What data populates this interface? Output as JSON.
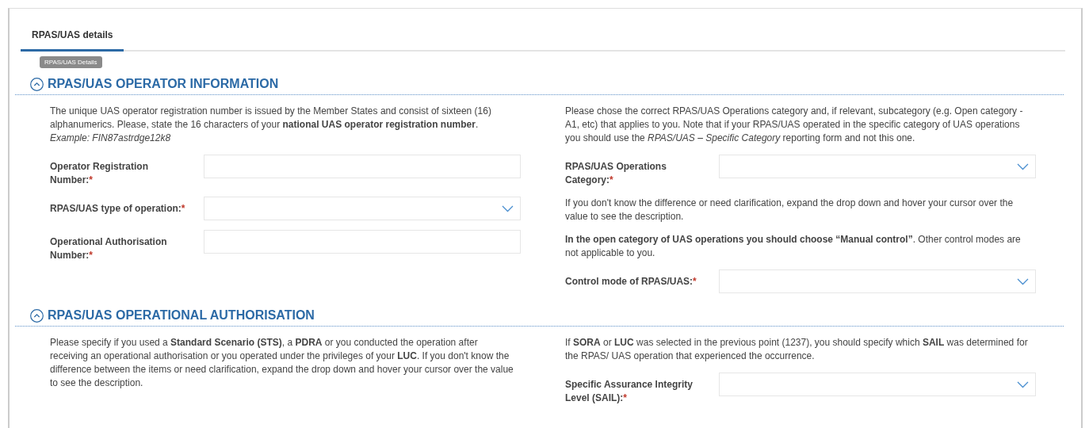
{
  "tabs": [
    {
      "label": "RPAS/UAS details",
      "selected": true
    }
  ],
  "badge": "RPAS/UAS Details",
  "sections": [
    {
      "title": "RPAS/UAS OPERATOR INFORMATION",
      "expanded": true,
      "columns": [
        [
          {
            "kind": "text",
            "text": "The unique UAS operator registration number is issued by the Member States and consist of sixteen (16) alphanumerics. Please, state the 16 characters of your **national UAS operator registration number**."
          },
          {
            "kind": "example",
            "text": "Example: FIN87astrdge12k8"
          },
          {
            "kind": "text-field",
            "label": "Operator Registration Number:",
            "mark": "*"
          },
          {
            "kind": "select-field",
            "label": "RPAS/UAS type of operation:",
            "mark": "*"
          },
          {
            "kind": "text-field",
            "label": "Operational Authorisation Number:",
            "mark": "*"
          }
        ],
        [
          {
            "kind": "text",
            "text": "Please chose the correct RPAS/UAS Operations category and, if relevant, subcategory (e.g. Open category - A1, etc) that applies to you. Note that if your RPAS/UAS operated in the specific category of UAS operations you should use the *RPAS/UAS – Specific Category* reporting form and not this one."
          },
          {
            "kind": "select-field",
            "label": "RPAS/UAS Operations Category:",
            "mark": "*"
          },
          {
            "kind": "text",
            "text": "If you don't know the difference or need clarification, expand the drop down and hover your cursor over the value to see the description."
          },
          {
            "kind": "text",
            "text": "**In the open category of UAS operations you should choose “Manual control”**. Other control modes are not applicable to you."
          },
          {
            "kind": "select-field",
            "label": "Control mode of RPAS/UAS:",
            "mark": "*"
          }
        ]
      ]
    },
    {
      "title": "RPAS/UAS OPERATIONAL AUTHORISATION",
      "expanded": true,
      "columns": [
        [
          {
            "kind": "text",
            "text": "Please specify if you used a **Standard Scenario (STS)**, a **PDRA** or you conducted the operation after receiving an operational authorisation or you operated under the privileges of your **LUC**. If you don't know the difference between the items or need clarification, expand the drop down and hover your cursor over the value to see the description."
          }
        ],
        [
          {
            "kind": "text",
            "text": "If **SORA** or **LUC** was selected in the previous point (1237), you should specify which **SAIL** was determined for the RPAS/ UAS operation that experienced the occurrence."
          },
          {
            "kind": "select-field",
            "label": "Specific Assurance Integrity Level (SAIL):",
            "mark": "*"
          }
        ]
      ]
    }
  ]
}
